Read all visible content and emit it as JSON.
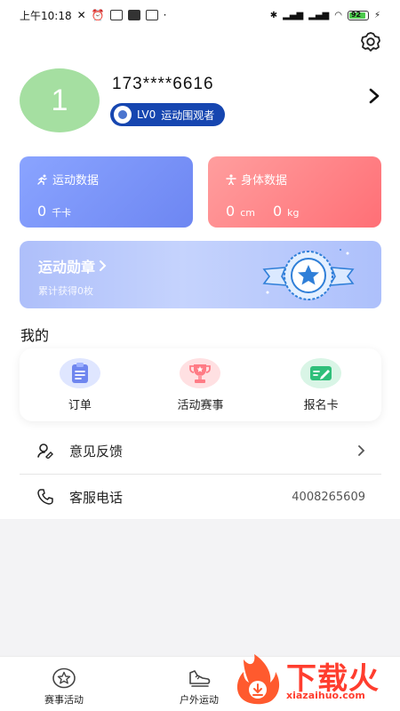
{
  "status_bar": {
    "time": "上午10:18",
    "dot": "·",
    "battery": "92"
  },
  "profile": {
    "avatar_text": "1",
    "phone": "173****6616",
    "level": "LV0",
    "level_title": "运动围观者"
  },
  "cards": {
    "sport": {
      "title": "运动数据",
      "value": "0",
      "unit": "千卡"
    },
    "body": {
      "title": "身体数据",
      "value1": "0",
      "unit1": "cm",
      "value2": "0",
      "unit2": "kg"
    }
  },
  "medal": {
    "title": "运动勋章",
    "subtitle": "累计获得0枚"
  },
  "section_title": "我的",
  "mine_items": [
    {
      "label": "订单",
      "icon": "clipboard-icon"
    },
    {
      "label": "活动赛事",
      "icon": "trophy-icon"
    },
    {
      "label": "报名卡",
      "icon": "pen-card-icon"
    }
  ],
  "list": {
    "feedback": {
      "label": "意见反馈"
    },
    "service": {
      "label": "客服电话",
      "phone": "4008265609"
    }
  },
  "tabbar": [
    {
      "label": "赛事活动",
      "icon": "star-circle-icon"
    },
    {
      "label": "户外运动",
      "icon": "shoe-icon"
    }
  ],
  "watermark": {
    "text": "下载火",
    "url": "xiazaihuo.com"
  },
  "colors": {
    "level_badge": "#1646b0",
    "sport_card": "#7b95f8",
    "body_card": "#ff8088",
    "medal_banner": "#b7c8fc",
    "watermark": "#ff3d2e"
  }
}
